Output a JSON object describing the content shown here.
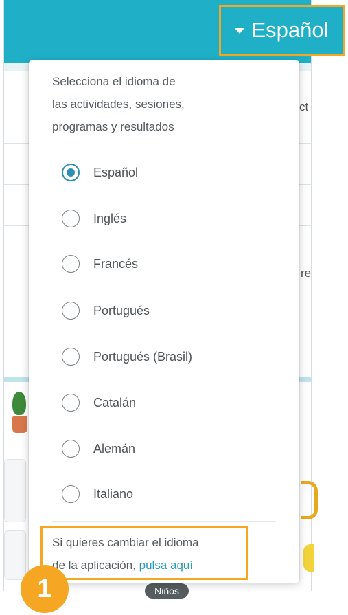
{
  "language_selector": {
    "current": "Español"
  },
  "dropdown": {
    "intro_line1": "Selecciona el idioma de",
    "intro_line2": "las actividades, sesiones,",
    "intro_line3": "programas y resultados",
    "options": [
      {
        "label": "Español",
        "selected": true
      },
      {
        "label": "Inglés",
        "selected": false
      },
      {
        "label": "Francés",
        "selected": false
      },
      {
        "label": "Portugués",
        "selected": false
      },
      {
        "label": "Portugués (Brasil)",
        "selected": false
      },
      {
        "label": "Catalán",
        "selected": false
      },
      {
        "label": "Alemán",
        "selected": false
      },
      {
        "label": "Italiano",
        "selected": false
      }
    ],
    "help_line1": "Si quieres cambiar el idioma",
    "help_line2_prefix": "de la aplicación, ",
    "help_link": "pulsa aquí"
  },
  "background": {
    "fragment_ct": "ct",
    "fragment_re": "re",
    "badge": "Niños"
  },
  "step_marker": "1",
  "colors": {
    "header": "#1fb0c8",
    "highlight": "#f5a623",
    "radio_checked": "#2f8fb0",
    "link": "#2a9cc0"
  }
}
